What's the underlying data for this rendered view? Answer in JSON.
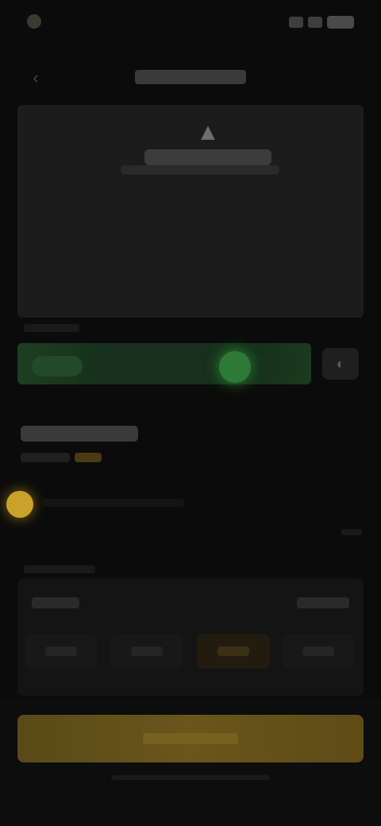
{
  "status_bar": {
    "time": "",
    "icons": [
      "signal-icon",
      "wifi-icon",
      "battery-icon"
    ]
  },
  "header": {
    "title": "",
    "back_icon": "back-arrow-icon"
  },
  "preview": {
    "icon": "upload-icon",
    "caption": ""
  },
  "progress": {
    "label": "",
    "left_pill": "",
    "level_fraction": 0.78,
    "end_icon": "toggle-icon",
    "colors": {
      "track": "#16301b",
      "knob": "#2d7a36"
    }
  },
  "section": {
    "title": "",
    "subtitle": "",
    "accent": ""
  },
  "bullet": {
    "text": "",
    "meta": ""
  },
  "panel": {
    "heading": "",
    "label_left": "",
    "label_right": "",
    "options": [
      "",
      "",
      "",
      ""
    ],
    "selected_index": 2
  },
  "cta": {
    "label": ""
  },
  "colors": {
    "accent_gold": "#c9a22a",
    "accent_green": "#2d7a36",
    "background": "#0b0b0b"
  }
}
